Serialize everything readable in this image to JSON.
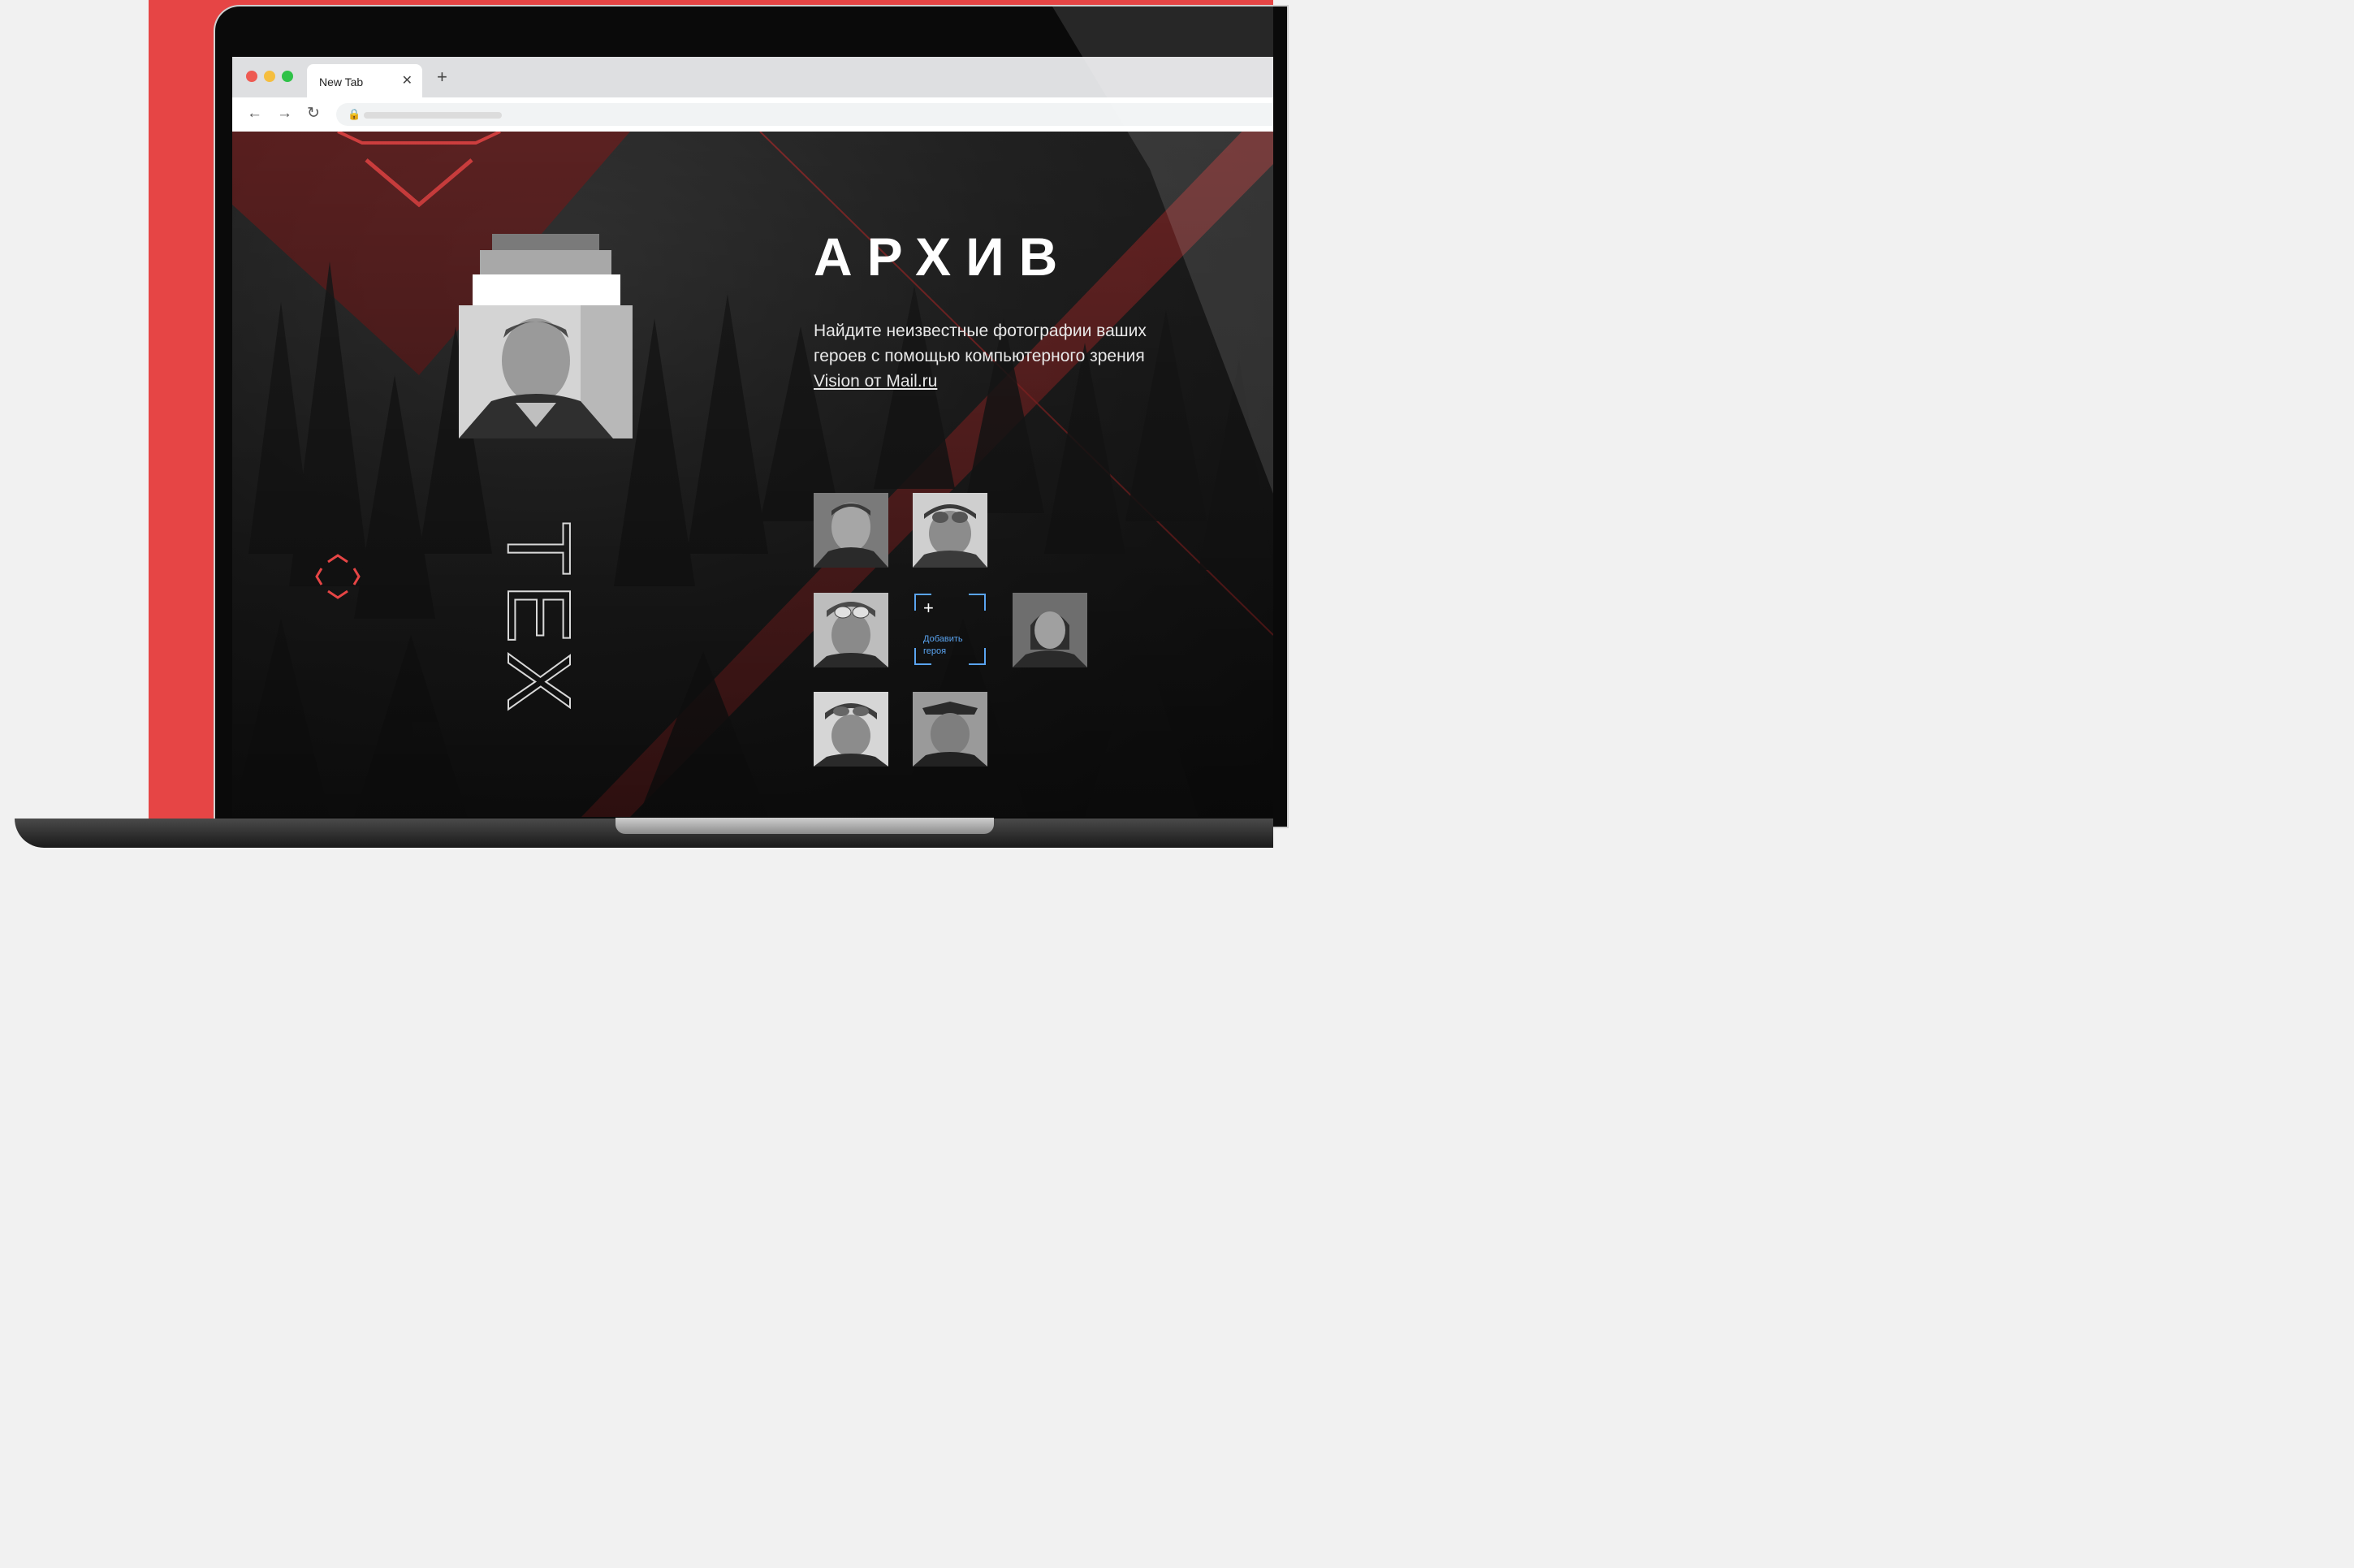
{
  "browser": {
    "tab_title": "New Tab",
    "tab_close_icon": "close-icon",
    "new_tab_icon": "plus-icon",
    "nav": {
      "back_icon": "arrow-left-icon",
      "forward_icon": "arrow-right-icon",
      "reload_icon": "reload-icon",
      "lock_icon": "lock-icon"
    },
    "traffic_colors": [
      "#ee5a52",
      "#f5be3f",
      "#2fc248"
    ]
  },
  "hero": {
    "title": "АРХИВ",
    "description_part1": "Найдите неизвестные фотографии ваших героев с помощью компьютерного зрения ",
    "description_link": "Vision от Mail.ru"
  },
  "add_hero": {
    "label_line1": "Добавить",
    "label_line2": "героя"
  },
  "vertical_text": "TEX",
  "colors": {
    "accent_red": "#e64545",
    "link_blue": "#5aa4f0"
  }
}
